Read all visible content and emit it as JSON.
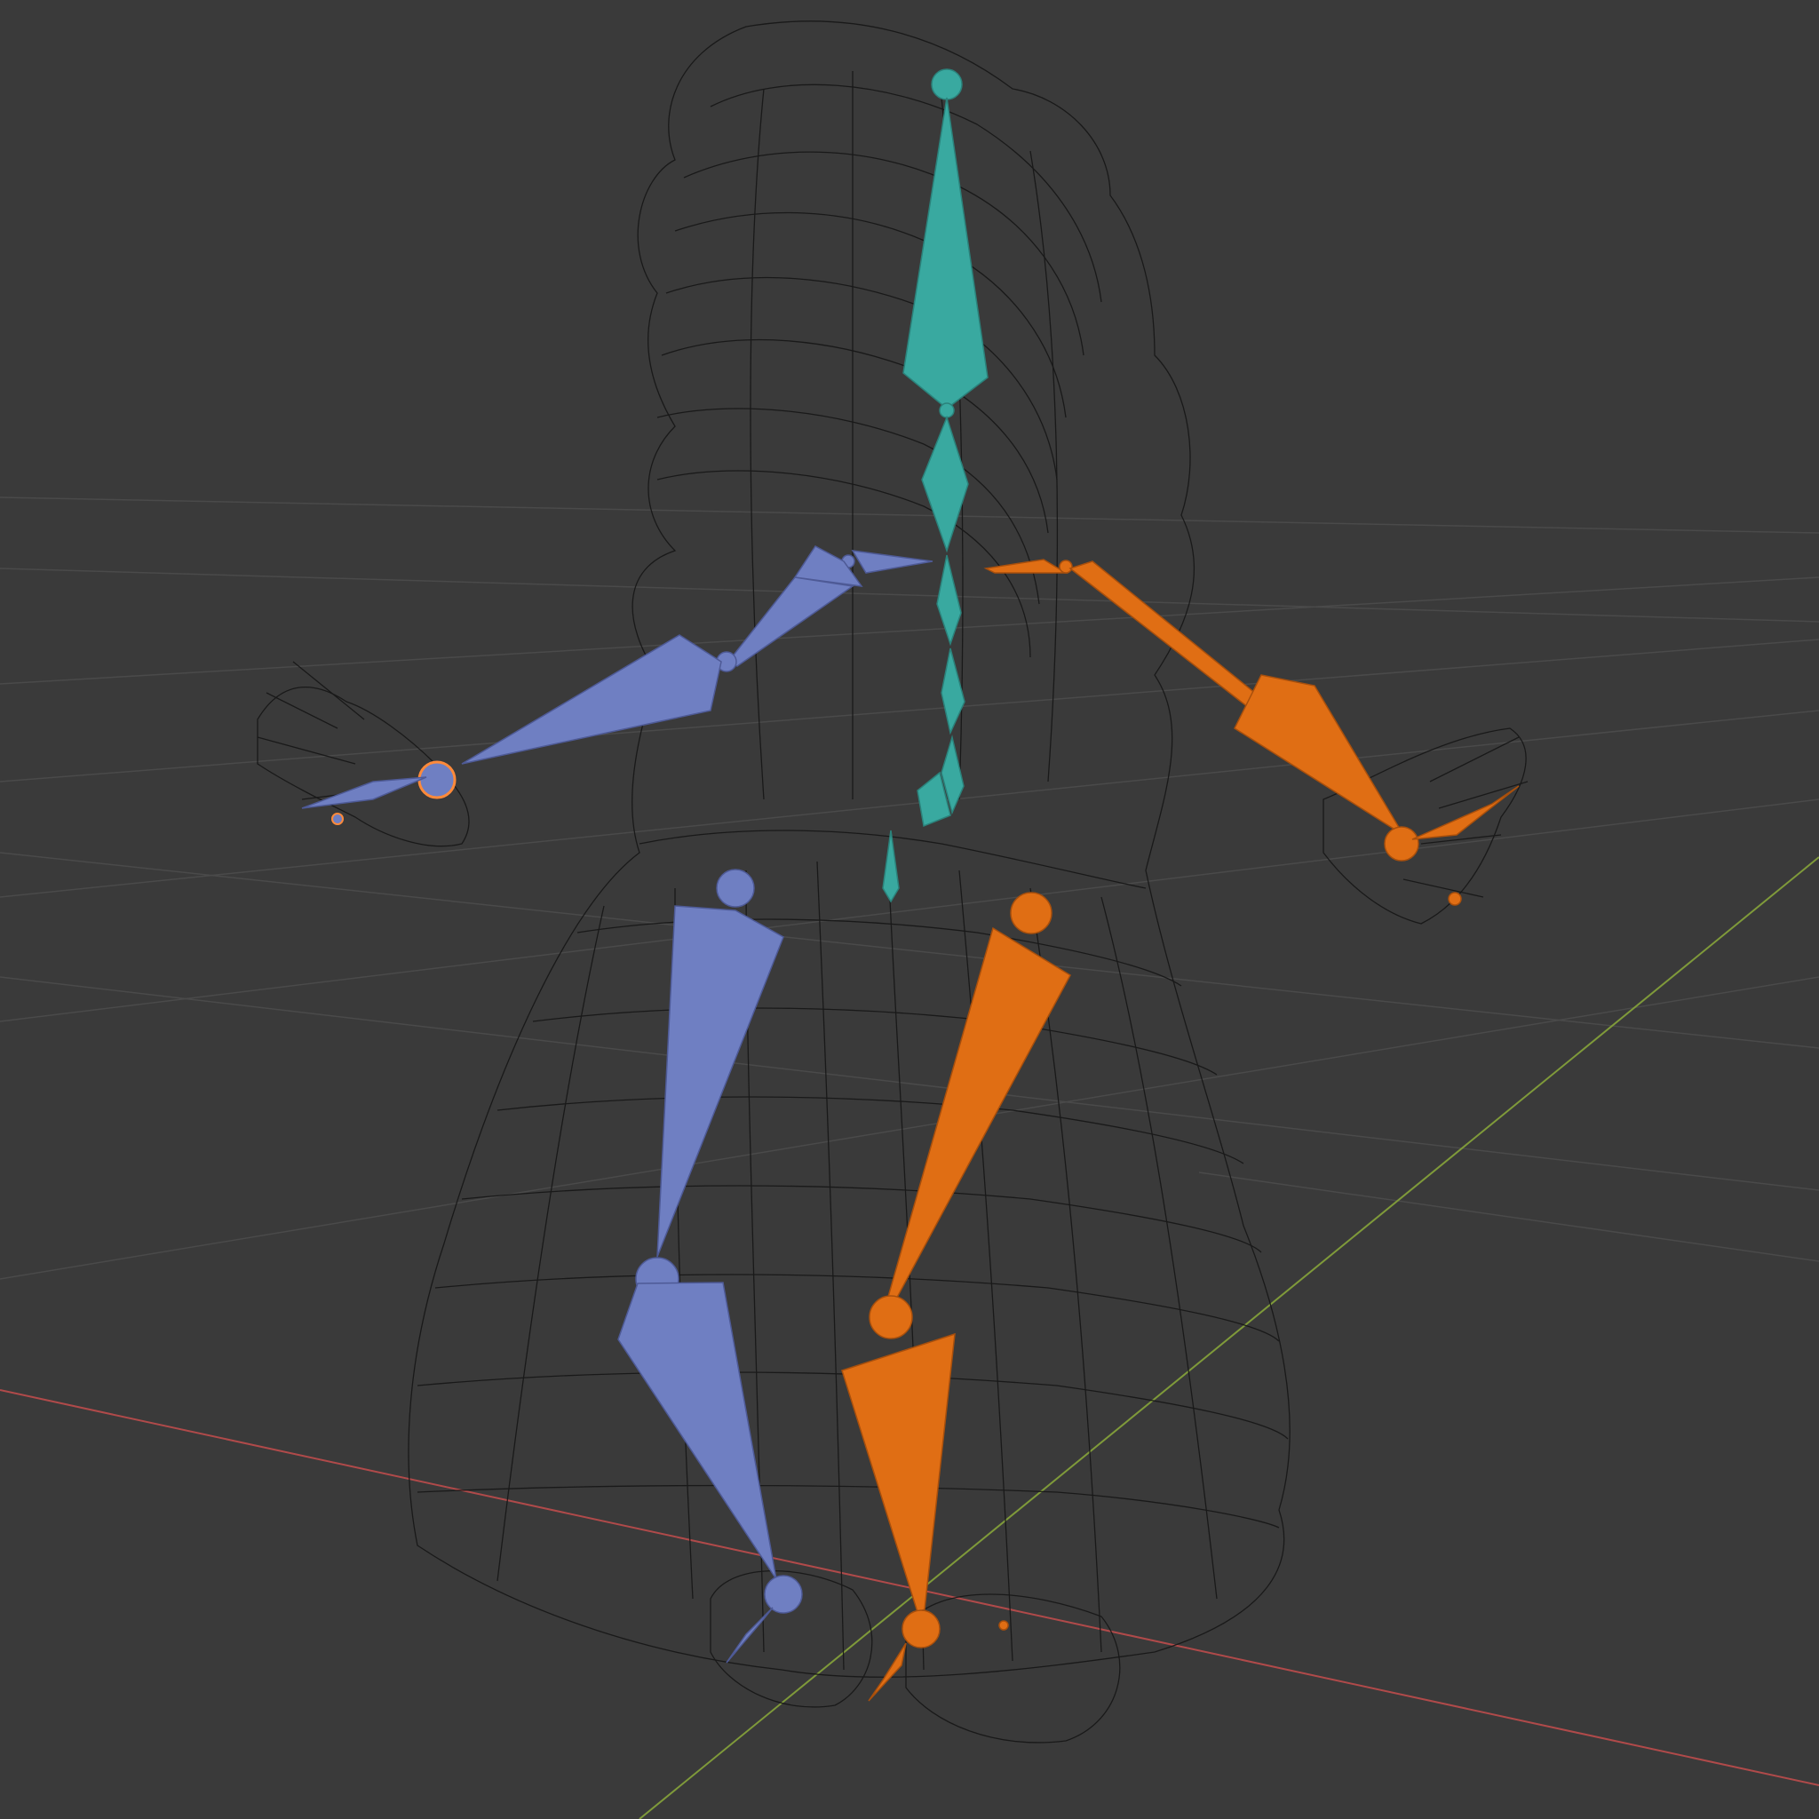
{
  "viewport": {
    "shading": "wireframe",
    "background_color": "#3a3a3a",
    "grid_color": "#4a4a4a",
    "x_axis_color": "#b04a4a",
    "y_axis_color": "#7f9a3a",
    "wire_color": "#111111"
  },
  "armature": {
    "colors": {
      "center": "#39a9a0",
      "left": "#6f7fc2",
      "right": "#e06e14",
      "selected_outline": "#ff8a3a"
    },
    "bone_groups": [
      "spine",
      "left-arm",
      "right-arm",
      "left-leg",
      "right-leg"
    ]
  }
}
